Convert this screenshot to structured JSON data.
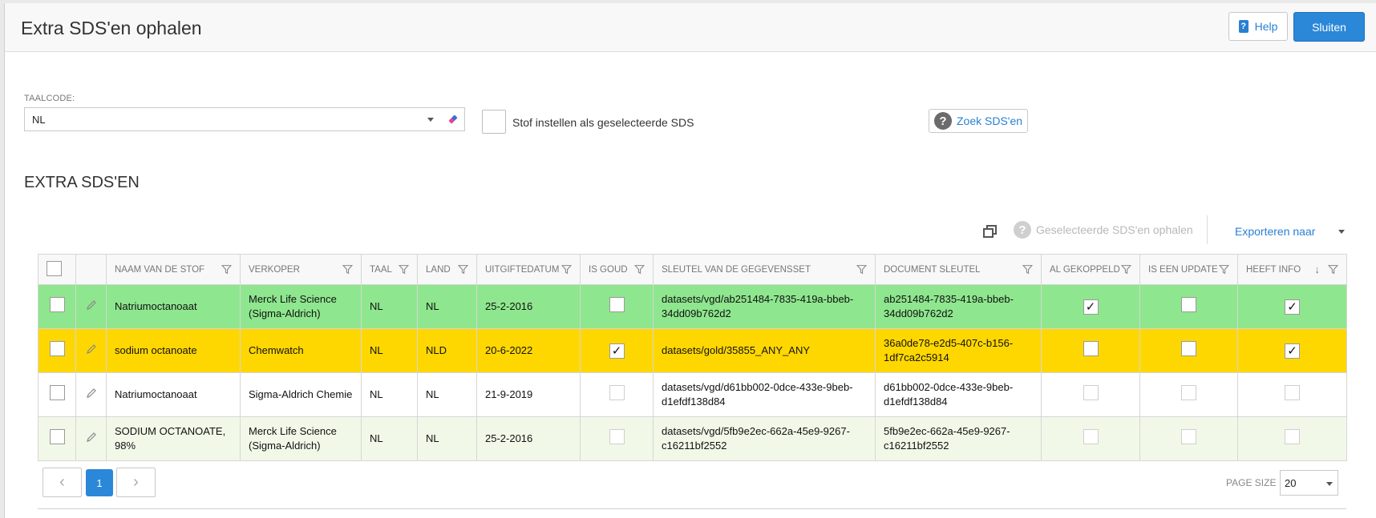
{
  "dialog": {
    "title": "Extra SDS'en ophalen",
    "help_label": "Help",
    "help_icon": "book-icon",
    "close_label": "Sluiten"
  },
  "form": {
    "taalcode_label": "TAALCODE:",
    "taalcode_value": "NL",
    "stof_label": "Stof instellen als geselecteerde SDS",
    "zoek_label": "Zoek SDS'en"
  },
  "section": {
    "title": "EXTRA SDS'EN"
  },
  "toolbar": {
    "fetch_label": "Geselecteerde SDS'en ophalen",
    "export_label": "Exporteren naar"
  },
  "colors": {
    "accent": "#2b87d8",
    "row_green": "#8ee68e",
    "row_yellow": "#ffd700",
    "row_light": "#f1f8e8"
  },
  "table": {
    "columns": [
      "NAAM VAN DE STOF",
      "VERKOPER",
      "TAAL",
      "LAND",
      "UITGIFTEDATUM",
      "IS GOUD",
      "SLEUTEL VAN DE GEGEVENSSET",
      "DOCUMENT SLEUTEL",
      "AL GEKOPPELD",
      "IS EEN UPDATE",
      "HEEFT INFO"
    ],
    "sorted_column": "HEEFT INFO",
    "sort_direction": "descending",
    "rows": [
      {
        "highlight": "green",
        "naam": "Natriumoctanoaat",
        "verkoper": "Merck Life Science (Sigma-Aldrich)",
        "taal": "NL",
        "land": "NL",
        "datum": "25-2-2016",
        "is_goud": false,
        "sleutel": "datasets/vgd/ab251484-7835-419a-bbeb-34dd09b762d2",
        "doc_sleutel": "ab251484-7835-419a-bbeb-34dd09b762d2",
        "al_gekoppeld": true,
        "is_update": false,
        "heeft_info": true
      },
      {
        "highlight": "yellow",
        "naam": "sodium octanoate",
        "verkoper": "Chemwatch",
        "taal": "NL",
        "land": "NLD",
        "datum": "20-6-2022",
        "is_goud": true,
        "sleutel": "datasets/gold/35855_ANY_ANY",
        "doc_sleutel": "36a0de78-e2d5-407c-b156-1df7ca2c5914",
        "al_gekoppeld": false,
        "is_update": false,
        "heeft_info": true
      },
      {
        "highlight": "none",
        "naam": "Natriumoctanoaat",
        "verkoper": "Sigma-Aldrich Chemie",
        "taal": "NL",
        "land": "NL",
        "datum": "21-9-2019",
        "is_goud": false,
        "sleutel": "datasets/vgd/d61bb002-0dce-433e-9beb-d1efdf138d84",
        "doc_sleutel": "d61bb002-0dce-433e-9beb-d1efdf138d84",
        "al_gekoppeld": false,
        "is_update": false,
        "heeft_info": false
      },
      {
        "highlight": "alternate",
        "naam": "SODIUM OCTANOATE, 98%",
        "verkoper": "Merck Life Science (Sigma-Aldrich)",
        "taal": "NL",
        "land": "NL",
        "datum": "25-2-2016",
        "is_goud": false,
        "sleutel": "datasets/vgd/5fb9e2ec-662a-45e9-9267-c16211bf2552",
        "doc_sleutel": "5fb9e2ec-662a-45e9-9267-c16211bf2552",
        "al_gekoppeld": false,
        "is_update": false,
        "heeft_info": false
      }
    ]
  },
  "pager": {
    "current_page": "1",
    "page_size_label": "PAGE SIZE",
    "page_size": "20"
  }
}
